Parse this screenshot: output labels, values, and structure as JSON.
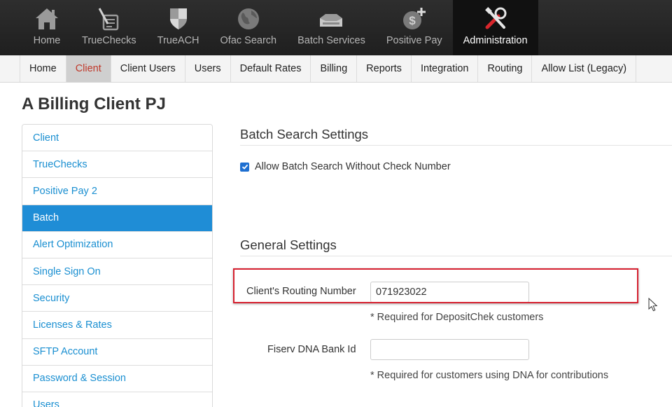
{
  "topnav": {
    "items": [
      {
        "label": "Home",
        "icon": "home-icon",
        "active": false
      },
      {
        "label": "TrueChecks",
        "icon": "check-pen-icon",
        "active": false
      },
      {
        "label": "TrueACH",
        "icon": "shield-icon",
        "active": false
      },
      {
        "label": "Ofac Search",
        "icon": "globe-icon",
        "active": false
      },
      {
        "label": "Batch Services",
        "icon": "tray-icon",
        "active": false
      },
      {
        "label": "Positive Pay",
        "icon": "money-plus-icon",
        "active": false
      },
      {
        "label": "Administration",
        "icon": "tools-icon",
        "active": true
      }
    ]
  },
  "subnav": {
    "items": [
      {
        "label": "Home",
        "active": false
      },
      {
        "label": "Client",
        "active": true
      },
      {
        "label": "Client Users",
        "active": false
      },
      {
        "label": "Users",
        "active": false
      },
      {
        "label": "Default Rates",
        "active": false
      },
      {
        "label": "Billing",
        "active": false
      },
      {
        "label": "Reports",
        "active": false
      },
      {
        "label": "Integration",
        "active": false
      },
      {
        "label": "Routing",
        "active": false
      },
      {
        "label": "Allow List (Legacy)",
        "active": false
      }
    ]
  },
  "page_title": "A Billing Client PJ",
  "sidebar": {
    "items": [
      {
        "label": "Client",
        "active": false
      },
      {
        "label": "TrueChecks",
        "active": false
      },
      {
        "label": "Positive Pay 2",
        "active": false
      },
      {
        "label": "Batch",
        "active": true
      },
      {
        "label": "Alert Optimization",
        "active": false
      },
      {
        "label": "Single Sign On",
        "active": false
      },
      {
        "label": "Security",
        "active": false
      },
      {
        "label": "Licenses & Rates",
        "active": false
      },
      {
        "label": "SFTP Account",
        "active": false
      },
      {
        "label": "Password & Session",
        "active": false
      },
      {
        "label": "Users",
        "active": false
      }
    ]
  },
  "batch_search": {
    "title": "Batch Search Settings",
    "allow_without_check_label": "Allow Batch Search Without Check Number",
    "allow_without_check_checked": true
  },
  "general": {
    "title": "General Settings",
    "routing_label": "Client's Routing Number",
    "routing_value": "071923022",
    "routing_help": "* Required for DepositChek customers",
    "fiserv_label": "Fiserv DNA Bank Id",
    "fiserv_value": "",
    "fiserv_help": "* Required for customers using DNA for contributions"
  },
  "colors": {
    "accent": "#1f8dd6",
    "active_subnav_text": "#c0392b",
    "highlight": "#d6202f"
  }
}
